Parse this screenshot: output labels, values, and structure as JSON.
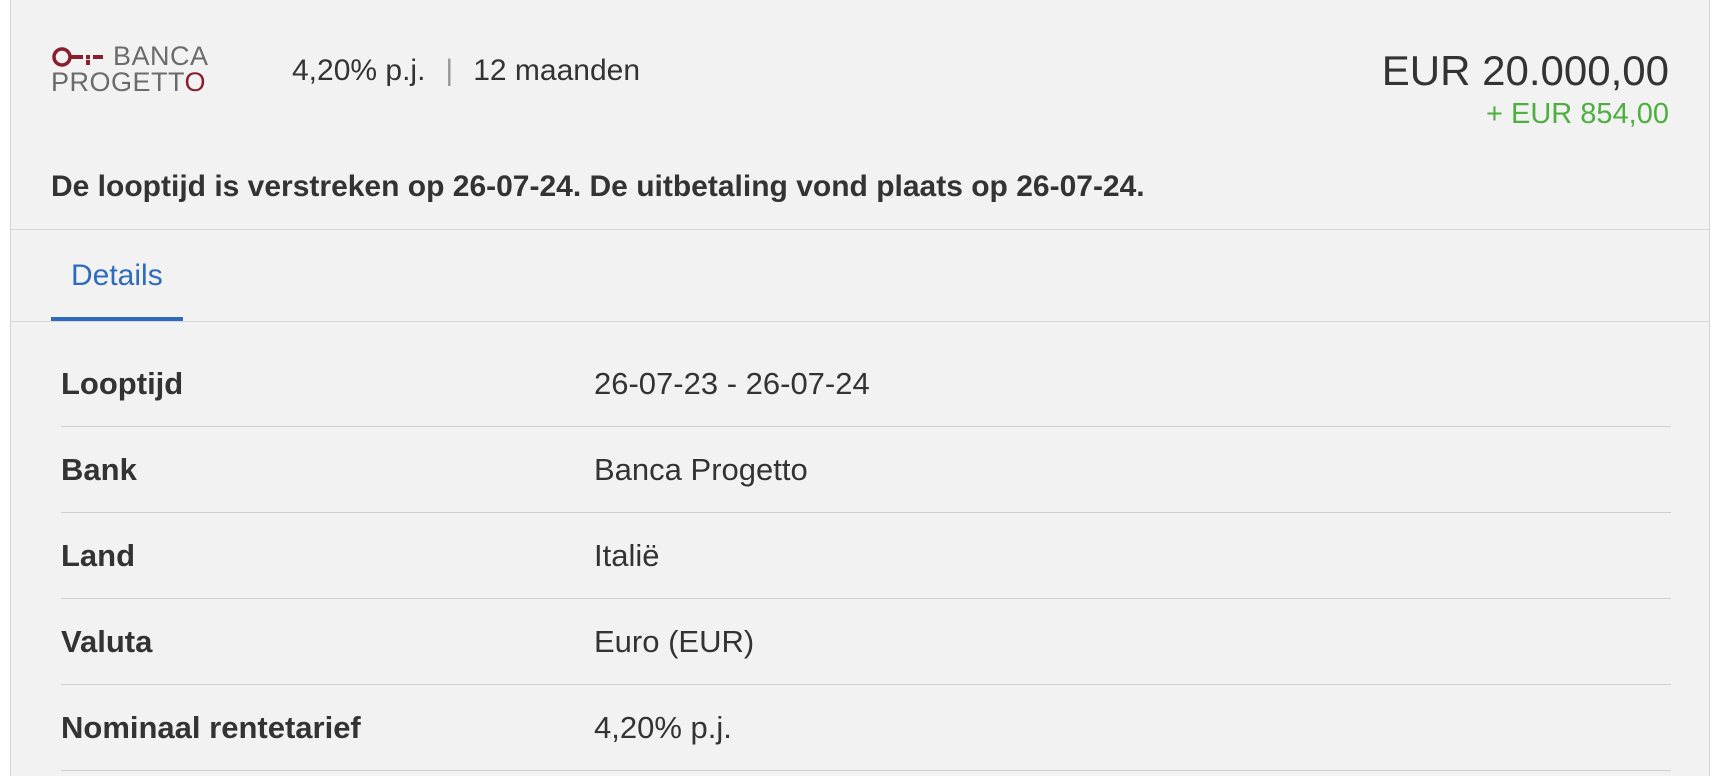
{
  "header": {
    "logo": {
      "line1": "BANCA",
      "line2_prefix": "PROGETT",
      "line2_last": "O"
    },
    "rate": "4,20% p.j.",
    "separator": "|",
    "term": "12 maanden",
    "amount": "EUR 20.000,00",
    "interest": "+ EUR 854,00",
    "notice": "De looptijd is verstreken op 26-07-24. De uitbetaling vond plaats op 26-07-24."
  },
  "tabs": [
    {
      "label": "Details",
      "active": true
    }
  ],
  "details": [
    {
      "label": "Looptijd",
      "value": "26-07-23 - 26-07-24"
    },
    {
      "label": "Bank",
      "value": "Banca Progetto"
    },
    {
      "label": "Land",
      "value": "Italië"
    },
    {
      "label": "Valuta",
      "value": "Euro (EUR)"
    },
    {
      "label": "Nominaal rentetarief",
      "value": "4,20% p.j."
    }
  ],
  "colors": {
    "accent": "#2f6bbd",
    "gain": "#4caf3e",
    "brand": "#8a1e2f",
    "background": "#f2f2f2"
  }
}
